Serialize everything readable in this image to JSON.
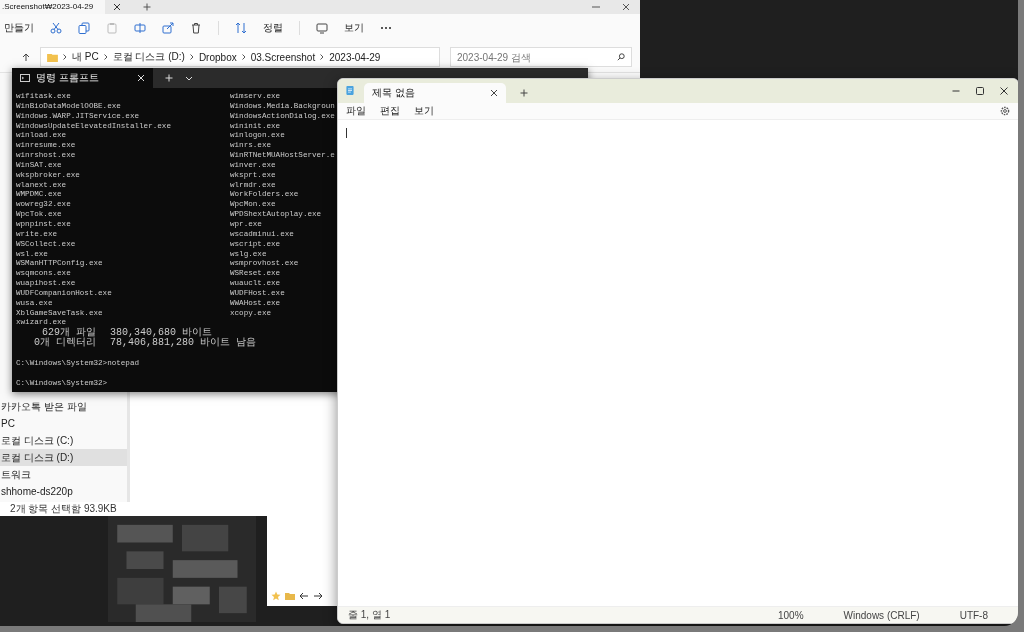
{
  "explorer": {
    "tab": {
      "title": ".Screenshot₩2023-04-29"
    },
    "toolbar": {
      "new_label": "만들기",
      "sort_label": "정렬",
      "view_label": "보기"
    },
    "breadcrumb": [
      "내 PC",
      "로컬 디스크 (D:)",
      "Dropbox",
      "03.Screenshot",
      "2023-04-29"
    ],
    "search": {
      "placeholder": "2023-04-29 검색"
    },
    "sidebar": {
      "items": [
        {
          "label": "카카오톡 받은 파일",
          "selected": false
        },
        {
          "label": "PC",
          "selected": false
        },
        {
          "label": "로컬 디스크 (C:)",
          "selected": false
        },
        {
          "label": "로컬 디스크 (D:)",
          "selected": true
        },
        {
          "label": "트워크",
          "selected": false
        },
        {
          "label": "shhome-ds220p",
          "selected": false
        }
      ]
    },
    "status_bar": "2개 항목 선택함 93.9KB"
  },
  "terminal": {
    "tab": {
      "title": "명령 프롬프트"
    },
    "listing": [
      {
        "left": "wifitask.exe",
        "right": "wimserv.exe"
      },
      {
        "left": "WinBioDataModelOOBE.exe",
        "right": "Windows.Media.Backgroun"
      },
      {
        "left": "Windows.WARP.JITService.exe",
        "right": "WindowsActionDialog.exe"
      },
      {
        "left": "WindowsUpdateElevatedInstaller.exe",
        "right": "wininit.exe"
      },
      {
        "left": "winload.exe",
        "right": "winlogon.exe"
      },
      {
        "left": "winresume.exe",
        "right": "winrs.exe"
      },
      {
        "left": "winrshost.exe",
        "right": "WinRTNetMUAHostServer.e"
      },
      {
        "left": "WinSAT.exe",
        "right": "winver.exe"
      },
      {
        "left": "wkspbroker.exe",
        "right": "wksprt.exe"
      },
      {
        "left": "wlanext.exe",
        "right": "wlrmdr.exe"
      },
      {
        "left": "WMPDMC.exe",
        "right": "WorkFolders.exe"
      },
      {
        "left": "wowreg32.exe",
        "right": "WpcMon.exe"
      },
      {
        "left": "WpcTok.exe",
        "right": "WPDShextAutoplay.exe"
      },
      {
        "left": "wpnpinst.exe",
        "right": "wpr.exe"
      },
      {
        "left": "write.exe",
        "right": "wscadminui.exe"
      },
      {
        "left": "WSCollect.exe",
        "right": "wscript.exe"
      },
      {
        "left": "wsl.exe",
        "right": "wslg.exe"
      },
      {
        "left": "WSManHTTPConfig.exe",
        "right": "wsmprovhost.exe"
      },
      {
        "left": "wsqmcons.exe",
        "right": "WSReset.exe"
      },
      {
        "left": "wuapihost.exe",
        "right": "wuauclt.exe"
      },
      {
        "left": "WUDFCompanionHost.exe",
        "right": "WUDFHost.exe"
      },
      {
        "left": "wusa.exe",
        "right": "WWAHost.exe"
      },
      {
        "left": "XblGameSaveTask.exe",
        "right": "xcopy.exe"
      },
      {
        "left": "xwizard.exe"
      }
    ],
    "summary": [
      {
        "count": "629개 파일",
        "size": "380,340,680 바이트"
      },
      {
        "count": "0개 디렉터리",
        "size": "78,406,881,280 바이트 남음"
      }
    ],
    "commands": [
      "C:\\Windows\\System32>notepad",
      "C:\\Windows\\System32>"
    ]
  },
  "notepad": {
    "tab": {
      "title": "제목 없음"
    },
    "menu": [
      "파일",
      "편집",
      "보기"
    ],
    "status_bar": {
      "position": "줄 1, 열 1",
      "zoom": "100%",
      "line_ending": "Windows (CRLF)",
      "encoding": "UTF-8"
    }
  }
}
